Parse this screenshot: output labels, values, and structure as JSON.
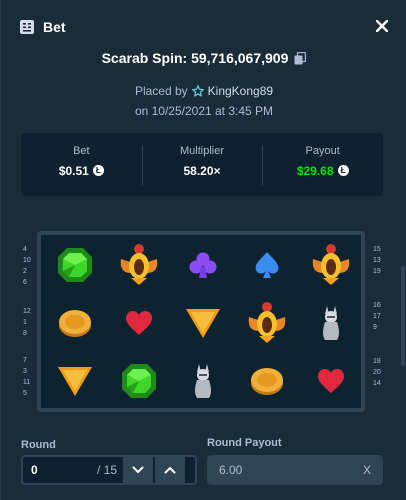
{
  "header": {
    "title": "Bet",
    "title_icon": "receipt-icon",
    "close_icon": "close-icon"
  },
  "spin": {
    "text": "Scarab Spin: 59,716,067,909",
    "copy_icon": "copy-icon"
  },
  "placed": {
    "prefix": "Placed by",
    "user": "KingKong89",
    "user_icon": "vip-star-icon",
    "date": "on 10/25/2021 at 3:45 PM"
  },
  "stats": {
    "bet_label": "Bet",
    "bet_value": "$0.51",
    "multiplier_label": "Multiplier",
    "multiplier_value": "58.20×",
    "payout_label": "Payout",
    "payout_value": "$29.68",
    "currency_icon": "litecoin-icon",
    "currency_glyph": "Ł",
    "payout_color": "#00e701"
  },
  "reels": {
    "rows": [
      [
        "green-gem",
        "scarab",
        "purple-club",
        "blue-spade",
        "scarab"
      ],
      [
        "gold-coin",
        "red-heart",
        "orange-triangle",
        "scarab",
        "grey-cat"
      ],
      [
        "orange-triangle",
        "green-gem",
        "grey-cat",
        "gold-coin",
        "red-heart"
      ]
    ],
    "left_paylines": [
      [
        "4",
        "10",
        "2",
        "6"
      ],
      [
        "12",
        "1",
        "8"
      ],
      [
        "7",
        "3",
        "11",
        "5"
      ]
    ],
    "right_paylines": [
      [
        "15",
        "13",
        "19"
      ],
      [
        "16",
        "17",
        "9"
      ],
      [
        "18",
        "20",
        "14"
      ]
    ]
  },
  "footer": {
    "round_label": "Round",
    "round_value": "0",
    "round_total": "/ 15",
    "round_payout_label": "Round Payout",
    "round_payout_value": "6.00",
    "payout_suffix": "X"
  }
}
